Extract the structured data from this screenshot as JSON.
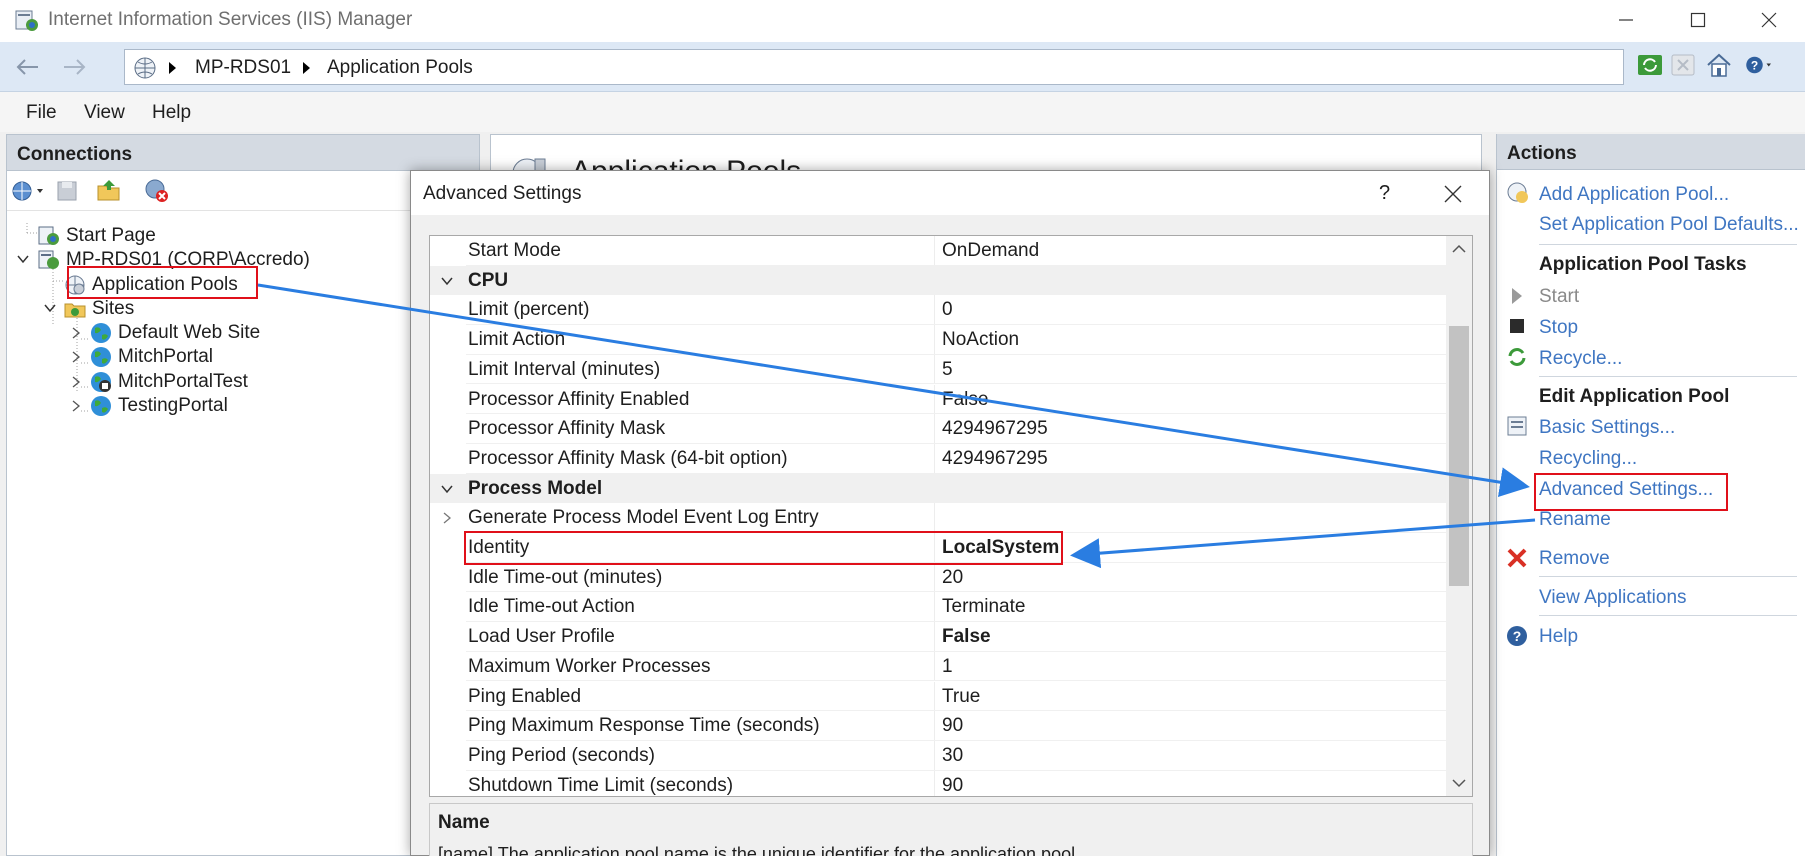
{
  "window": {
    "title": "Internet Information Services (IIS) Manager"
  },
  "address": {
    "breadcrumbs": [
      "MP-RDS01",
      "Application Pools"
    ]
  },
  "menu": [
    "File",
    "View",
    "Help"
  ],
  "connections": {
    "header": "Connections",
    "tree": {
      "start_page": "Start Page",
      "server": "MP-RDS01 (CORP\\Accredo)",
      "app_pools": "Application Pools",
      "sites": "Sites",
      "site_items": [
        "Default Web Site",
        "MitchPortal",
        "MitchPortalTest",
        "TestingPortal"
      ]
    }
  },
  "center": {
    "title": "Application Pools"
  },
  "actions": {
    "header": "Actions",
    "add_pool": "Add Application Pool...",
    "set_defaults": "Set Application Pool Defaults...",
    "tasks_header": "Application Pool Tasks",
    "start": "Start",
    "stop": "Stop",
    "recycle": "Recycle...",
    "edit_header": "Edit Application Pool",
    "basic_settings": "Basic Settings...",
    "recycling": "Recycling...",
    "advanced_settings": "Advanced Settings...",
    "rename": "Rename",
    "remove": "Remove",
    "view_apps": "View Applications",
    "help": "Help"
  },
  "dialog": {
    "title": "Advanced Settings",
    "help_glyph": "?",
    "rows": [
      {
        "kind": "prop",
        "name": "Start Mode",
        "value": "OnDemand",
        "bold": false
      },
      {
        "kind": "cat",
        "name": "CPU",
        "expanded": true
      },
      {
        "kind": "prop",
        "name": "Limit (percent)",
        "value": "0",
        "bold": false
      },
      {
        "kind": "prop",
        "name": "Limit Action",
        "value": "NoAction",
        "bold": false
      },
      {
        "kind": "prop",
        "name": "Limit Interval (minutes)",
        "value": "5",
        "bold": false
      },
      {
        "kind": "prop",
        "name": "Processor Affinity Enabled",
        "value": "False",
        "bold": false
      },
      {
        "kind": "prop",
        "name": "Processor Affinity Mask",
        "value": "4294967295",
        "bold": false
      },
      {
        "kind": "prop",
        "name": "Processor Affinity Mask (64-bit option)",
        "value": "4294967295",
        "bold": false
      },
      {
        "kind": "cat",
        "name": "Process Model",
        "expanded": true
      },
      {
        "kind": "sub",
        "name": "Generate Process Model Event Log Entry",
        "value": "",
        "bold": false
      },
      {
        "kind": "prop",
        "name": "Identity",
        "value": "LocalSystem",
        "bold": true
      },
      {
        "kind": "prop",
        "name": "Idle Time-out (minutes)",
        "value": "20",
        "bold": false
      },
      {
        "kind": "prop",
        "name": "Idle Time-out Action",
        "value": "Terminate",
        "bold": false
      },
      {
        "kind": "prop",
        "name": "Load User Profile",
        "value": "False",
        "bold": true
      },
      {
        "kind": "prop",
        "name": "Maximum Worker Processes",
        "value": "1",
        "bold": false
      },
      {
        "kind": "prop",
        "name": "Ping Enabled",
        "value": "True",
        "bold": false
      },
      {
        "kind": "prop",
        "name": "Ping Maximum Response Time (seconds)",
        "value": "90",
        "bold": false
      },
      {
        "kind": "prop",
        "name": "Ping Period (seconds)",
        "value": "30",
        "bold": false
      },
      {
        "kind": "prop",
        "name": "Shutdown Time Limit (seconds)",
        "value": "90",
        "bold": false
      }
    ],
    "description": {
      "heading": "Name",
      "text": "[name] The application pool name is the unique identifier for the application pool."
    }
  },
  "colors": {
    "link": "#3f76c2",
    "annotation_red": "#e0101a",
    "annotation_arrow": "#2a7de1"
  }
}
